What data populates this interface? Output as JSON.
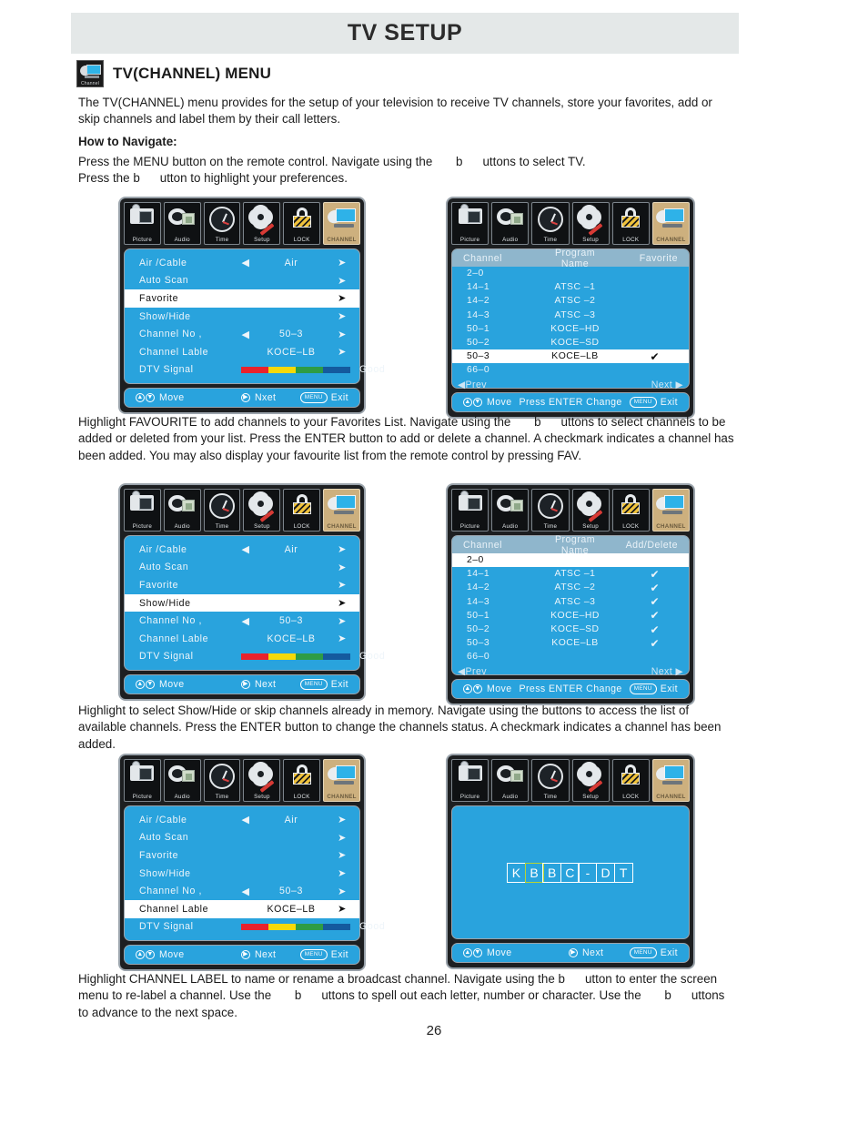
{
  "page": {
    "band_title": "TV SETUP",
    "section_title": "TV(CHANNEL) MENU",
    "section_icon_label": "Channel",
    "page_number": "26",
    "intro": "The TV(CHANNEL) menu provides for the setup of your television to receive TV channels, store your favorites, add or skip channels and label them by their call letters.",
    "navigate_heading": "How to Navigate:",
    "navigate_line1_a": "Press the MENU button on the remote control. Navigate using the",
    "navigate_line1_b": "b",
    "navigate_line1_c": "uttons to select TV.",
    "navigate_line2_a": "Press the",
    "navigate_line2_b": "b",
    "navigate_line2_c": "utton to highlight your preferences.",
    "para_favourite": "Highlight FAVOURITE to add channels to your Favorites List. Navigate using the",
    "para_favourite_b": "b",
    "para_favourite_rest": "uttons to select channels to be added or deleted from your list. Press the ENTER button to add or delete a channel. A checkmark indicates a channel has been added. You may also display your favourite list from the remote control by pressing FAV.",
    "para_showhide": "Highlight to select Show/Hide or skip channels already in memory. Navigate using the buttons to access the list of available channels. Press the ENTER button to change the channels status. A checkmark indicates a channel has been added.",
    "para_label_a": "Highlight CHANNEL LABEL to name or rename a broadcast channel. Navigate using the",
    "para_label_b1": "b",
    "para_label_c": "utton to enter the screen menu to re-label a channel. Use the",
    "para_label_b2": "b",
    "para_label_d": "uttons to spell out each letter, number or character. Use the",
    "para_label_b3": "b",
    "para_label_e": "uttons to advance to the next space."
  },
  "colors": {
    "osd_blue": "#29a3dd",
    "tab_active": "#cdb07e",
    "band_gray": "#e4e8e8",
    "list_header": "#8fb6cc",
    "signal_red": "#e8222c",
    "signal_yellow": "#f5d908",
    "signal_green": "#2e9c45",
    "signal_blue": "#145a9e",
    "highlight_char": "#b9d432"
  },
  "tabs": [
    {
      "label": "Picture",
      "icon": "camera-icon",
      "active": false
    },
    {
      "label": "Audio",
      "icon": "audio-icon",
      "active": false
    },
    {
      "label": "Time",
      "icon": "clock-icon",
      "active": false
    },
    {
      "label": "Setup",
      "icon": "gear-icon",
      "active": false
    },
    {
      "label": "LOCK",
      "icon": "lock-icon",
      "active": false
    },
    {
      "label": "CHANNEL",
      "icon": "channel-icon",
      "active": true
    }
  ],
  "menu_rows": [
    {
      "label": "Air /Cable",
      "left_arrow": "◀",
      "value": "Air",
      "right_arrow": "➤"
    },
    {
      "label": "Auto Scan",
      "left_arrow": "",
      "value": "",
      "right_arrow": "➤"
    },
    {
      "label": "Favorite",
      "left_arrow": "",
      "value": "",
      "right_arrow": "➤"
    },
    {
      "label": "Show/Hide",
      "left_arrow": "",
      "value": "",
      "right_arrow": "➤"
    },
    {
      "label": "Channel No ,",
      "left_arrow": "◀",
      "value": "50–3",
      "right_arrow": "➤"
    },
    {
      "label": "Channel Lable",
      "left_arrow": "",
      "value": "KOCE–LB",
      "right_arrow": "➤"
    },
    {
      "label": "DTV Signal",
      "left_arrow": "",
      "value": "",
      "right_arrow": "",
      "signal": true,
      "signal_text": "Good"
    }
  ],
  "channel_list": {
    "header_favorite": {
      "c1": "Channel",
      "c2": "Program Name",
      "c3": "Favorite"
    },
    "header_adddelete": {
      "c1": "Channel",
      "c2": "Program Name",
      "c3": "Add/Delete"
    },
    "prev": "◀Prev",
    "next": "Next ▶",
    "rows_favorite": [
      {
        "channel": "2–0",
        "program": "",
        "mark": ""
      },
      {
        "channel": "14–1",
        "program": "ATSC –1",
        "mark": ""
      },
      {
        "channel": "14–2",
        "program": "ATSC –2",
        "mark": ""
      },
      {
        "channel": "14–3",
        "program": "ATSC –3",
        "mark": ""
      },
      {
        "channel": "50–1",
        "program": "KOCE–HD",
        "mark": ""
      },
      {
        "channel": "50–2",
        "program": "KOCE–SD",
        "mark": ""
      },
      {
        "channel": "50–3",
        "program": "KOCE–LB",
        "mark": "✔"
      },
      {
        "channel": "66–0",
        "program": "",
        "mark": ""
      }
    ],
    "rows_adddelete": [
      {
        "channel": "2–0",
        "program": "",
        "mark": ""
      },
      {
        "channel": "14–1",
        "program": "ATSC –1",
        "mark": "✔"
      },
      {
        "channel": "14–2",
        "program": "ATSC –2",
        "mark": "✔"
      },
      {
        "channel": "14–3",
        "program": "ATSC –3",
        "mark": "✔"
      },
      {
        "channel": "50–1",
        "program": "KOCE–HD",
        "mark": "✔"
      },
      {
        "channel": "50–2",
        "program": "KOCE–SD",
        "mark": "✔"
      },
      {
        "channel": "50–3",
        "program": "KOCE–LB",
        "mark": "✔"
      },
      {
        "channel": "66–0",
        "program": "",
        "mark": ""
      }
    ]
  },
  "label_editor": {
    "chars": [
      {
        "ch": "K",
        "highlight": false
      },
      {
        "ch": "B",
        "highlight": true
      },
      {
        "ch": "B",
        "highlight": false
      },
      {
        "ch": "C",
        "highlight": false
      },
      {
        "ch": "-",
        "highlight": false
      },
      {
        "ch": "D",
        "highlight": false
      },
      {
        "ch": "T",
        "highlight": false
      }
    ]
  },
  "footers": {
    "menu_nxet": {
      "move": "Move",
      "next": "Nxet",
      "menu_btn": "MENU",
      "exit": "Exit"
    },
    "menu_next": {
      "move": "Move",
      "next": "Next",
      "menu_btn": "MENU",
      "exit": "Exit"
    },
    "list": {
      "move": "Move",
      "press_enter": "Press ENTER Change",
      "menu_btn": "MENU",
      "exit": "Exit"
    }
  }
}
